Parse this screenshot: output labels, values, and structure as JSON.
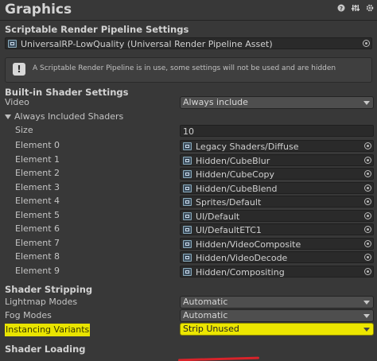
{
  "header": {
    "title": "Graphics",
    "icons": [
      "help-icon",
      "settings-sliders-icon",
      "gear-icon"
    ]
  },
  "srp": {
    "section_title": "Scriptable Render Pipeline Settings",
    "asset_value": "UniversalRP-LowQuality (Universal Render Pipeline Asset)",
    "info_text": "A Scriptable Render Pipeline is in use, some settings will not be used and are hidden"
  },
  "builtin": {
    "section_title": "Built-in Shader Settings",
    "video_label": "Video",
    "video_value": "Always include",
    "always_included_label": "Always Included Shaders",
    "size_label": "Size",
    "size_value": "10",
    "elements": [
      {
        "label": "Element 0",
        "value": "Legacy Shaders/Diffuse"
      },
      {
        "label": "Element 1",
        "value": "Hidden/CubeBlur"
      },
      {
        "label": "Element 2",
        "value": "Hidden/CubeCopy"
      },
      {
        "label": "Element 3",
        "value": "Hidden/CubeBlend"
      },
      {
        "label": "Element 4",
        "value": "Sprites/Default"
      },
      {
        "label": "Element 5",
        "value": "UI/Default"
      },
      {
        "label": "Element 6",
        "value": "UI/DefaultETC1"
      },
      {
        "label": "Element 7",
        "value": "Hidden/VideoComposite"
      },
      {
        "label": "Element 8",
        "value": "Hidden/VideoDecode"
      },
      {
        "label": "Element 9",
        "value": "Hidden/Compositing"
      }
    ]
  },
  "stripping": {
    "section_title": "Shader Stripping",
    "lightmap_label": "Lightmap Modes",
    "lightmap_value": "Automatic",
    "fog_label": "Fog Modes",
    "fog_value": "Automatic",
    "instancing_label": "Instancing Variants",
    "instancing_value": "Strip Unused"
  },
  "loading": {
    "section_title": "Shader Loading"
  },
  "colors": {
    "background": "#383838",
    "highlight": "#e9e400",
    "annotation_underline": "#d8232a"
  }
}
